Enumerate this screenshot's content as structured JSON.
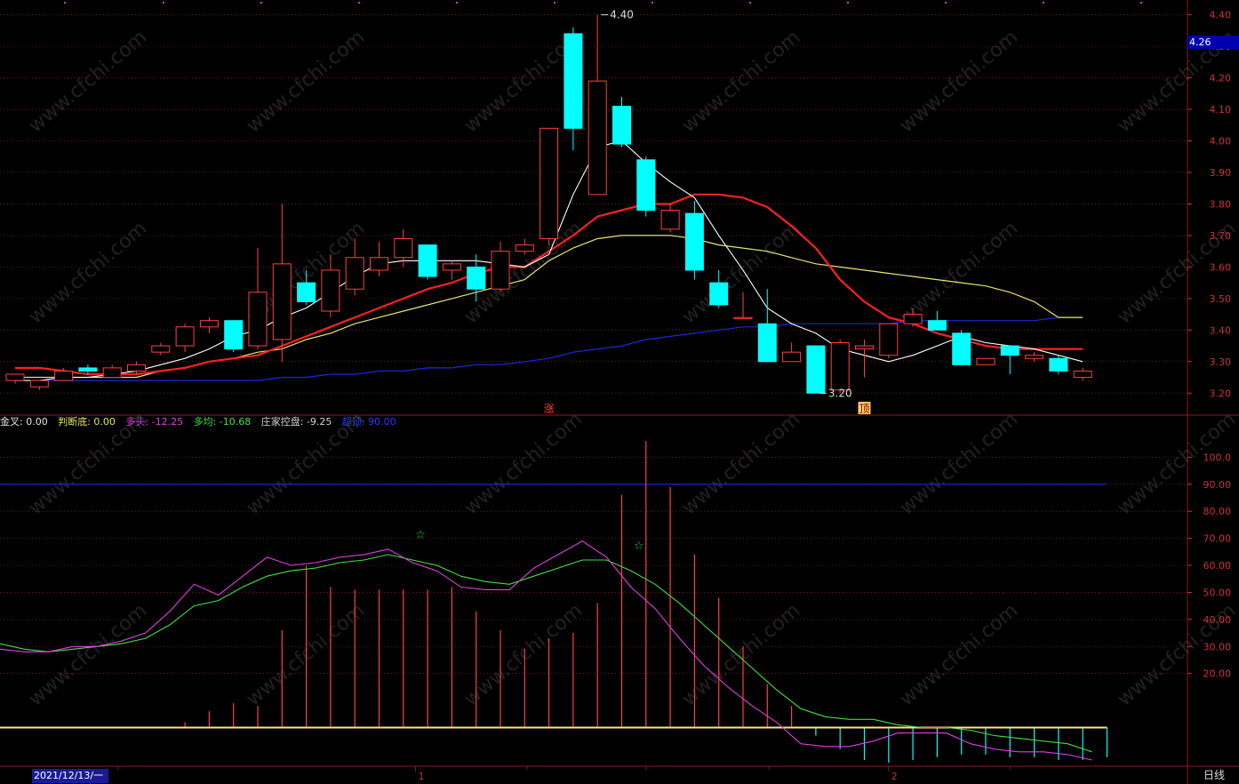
{
  "colors": {
    "up": "#ff4040",
    "down": "#00ffff",
    "ma5": "#ffffff",
    "ma10": "#ff2020",
    "ma20": "#e6e66e",
    "ma60": "#1a2adc",
    "grid": "#8b1a1a",
    "axis_text": "#cc3333",
    "k_line": "#e040e0",
    "d_line": "#40e040",
    "level_line": "#1a2adc",
    "zero_line": "#ffe28a"
  },
  "price_tag": "4.26",
  "chart_data": [
    {
      "type": "candlestick",
      "y_axis_ticks": [
        "3.20",
        "3.30",
        "3.40",
        "3.50",
        "3.60",
        "3.70",
        "3.80",
        "3.90",
        "4.00",
        "4.10",
        "4.20",
        "4.30",
        "4.40"
      ],
      "ylim": [
        3.15,
        4.43
      ],
      "grid": true,
      "candles": [
        {
          "o": 3.24,
          "h": 3.26,
          "l": 3.23,
          "c": 3.26
        },
        {
          "o": 3.22,
          "h": 3.24,
          "l": 3.21,
          "c": 3.24
        },
        {
          "o": 3.24,
          "h": 3.28,
          "l": 3.24,
          "c": 3.27
        },
        {
          "o": 3.28,
          "h": 3.29,
          "l": 3.26,
          "c": 3.27
        },
        {
          "o": 3.25,
          "h": 3.29,
          "l": 3.25,
          "c": 3.28
        },
        {
          "o": 3.27,
          "h": 3.3,
          "l": 3.26,
          "c": 3.29
        },
        {
          "o": 3.33,
          "h": 3.36,
          "l": 3.32,
          "c": 3.35
        },
        {
          "o": 3.35,
          "h": 3.42,
          "l": 3.33,
          "c": 3.41
        },
        {
          "o": 3.41,
          "h": 3.44,
          "l": 3.39,
          "c": 3.43
        },
        {
          "o": 3.43,
          "h": 3.43,
          "l": 3.33,
          "c": 3.34
        },
        {
          "o": 3.35,
          "h": 3.66,
          "l": 3.34,
          "c": 3.52
        },
        {
          "o": 3.37,
          "h": 3.8,
          "l": 3.3,
          "c": 3.61
        },
        {
          "o": 3.55,
          "h": 3.59,
          "l": 3.48,
          "c": 3.49
        },
        {
          "o": 3.46,
          "h": 3.64,
          "l": 3.44,
          "c": 3.59
        },
        {
          "o": 3.53,
          "h": 3.69,
          "l": 3.51,
          "c": 3.63
        },
        {
          "o": 3.59,
          "h": 3.68,
          "l": 3.57,
          "c": 3.63
        },
        {
          "o": 3.63,
          "h": 3.72,
          "l": 3.6,
          "c": 3.69
        },
        {
          "o": 3.67,
          "h": 3.67,
          "l": 3.56,
          "c": 3.57
        },
        {
          "o": 3.59,
          "h": 3.62,
          "l": 3.56,
          "c": 3.61
        },
        {
          "o": 3.6,
          "h": 3.64,
          "l": 3.49,
          "c": 3.53
        },
        {
          "o": 3.53,
          "h": 3.68,
          "l": 3.52,
          "c": 3.65
        },
        {
          "o": 3.65,
          "h": 3.69,
          "l": 3.64,
          "c": 3.67
        },
        {
          "o": 3.69,
          "h": 4.04,
          "l": 3.67,
          "c": 4.04
        },
        {
          "o": 4.34,
          "h": 4.36,
          "l": 3.97,
          "c": 4.04
        },
        {
          "o": 3.83,
          "h": 4.4,
          "l": 3.83,
          "c": 4.19
        },
        {
          "o": 4.11,
          "h": 4.14,
          "l": 3.98,
          "c": 3.99
        },
        {
          "o": 3.94,
          "h": 3.95,
          "l": 3.76,
          "c": 3.78
        },
        {
          "o": 3.72,
          "h": 3.8,
          "l": 3.71,
          "c": 3.78
        },
        {
          "o": 3.77,
          "h": 3.81,
          "l": 3.56,
          "c": 3.59
        },
        {
          "o": 3.55,
          "h": 3.59,
          "l": 3.47,
          "c": 3.48
        },
        {
          "o": 3.44,
          "h": 3.52,
          "l": 3.44,
          "c": 3.44
        },
        {
          "o": 3.42,
          "h": 3.53,
          "l": 3.3,
          "c": 3.3
        },
        {
          "o": 3.3,
          "h": 3.36,
          "l": 3.3,
          "c": 3.33
        },
        {
          "o": 3.35,
          "h": 3.35,
          "l": 3.2,
          "c": 3.2
        },
        {
          "o": 3.21,
          "h": 3.37,
          "l": 3.2,
          "c": 3.36
        },
        {
          "o": 3.34,
          "h": 3.37,
          "l": 3.25,
          "c": 3.35
        },
        {
          "o": 3.32,
          "h": 3.42,
          "l": 3.31,
          "c": 3.42
        },
        {
          "o": 3.42,
          "h": 3.47,
          "l": 3.41,
          "c": 3.45
        },
        {
          "o": 3.43,
          "h": 3.46,
          "l": 3.4,
          "c": 3.4
        },
        {
          "o": 3.39,
          "h": 3.4,
          "l": 3.29,
          "c": 3.29
        },
        {
          "o": 3.29,
          "h": 3.31,
          "l": 3.29,
          "c": 3.31
        },
        {
          "o": 3.35,
          "h": 3.35,
          "l": 3.26,
          "c": 3.32
        },
        {
          "o": 3.31,
          "h": 3.33,
          "l": 3.3,
          "c": 3.32
        },
        {
          "o": 3.31,
          "h": 3.32,
          "l": 3.26,
          "c": 3.27
        },
        {
          "o": 3.25,
          "h": 3.28,
          "l": 3.24,
          "c": 3.27
        }
      ],
      "ma5": [
        3.24,
        3.24,
        3.25,
        3.25,
        3.26,
        3.27,
        3.29,
        3.31,
        3.34,
        3.38,
        3.4,
        3.44,
        3.47,
        3.52,
        3.57,
        3.61,
        3.62,
        3.62,
        3.62,
        3.62,
        3.61,
        3.6,
        3.64,
        3.83,
        3.98,
        4.0,
        3.93,
        3.87,
        3.82,
        3.7,
        3.59,
        3.47,
        3.42,
        3.39,
        3.34,
        3.32,
        3.3,
        3.32,
        3.35,
        3.38,
        3.36,
        3.35,
        3.34,
        3.32,
        3.3
      ],
      "ma10": [
        3.28,
        3.28,
        3.27,
        3.26,
        3.26,
        3.26,
        3.27,
        3.28,
        3.3,
        3.31,
        3.32,
        3.35,
        3.38,
        3.41,
        3.44,
        3.47,
        3.5,
        3.53,
        3.55,
        3.58,
        3.6,
        3.6,
        3.65,
        3.7,
        3.76,
        3.78,
        3.8,
        3.8,
        3.83,
        3.83,
        3.82,
        3.79,
        3.73,
        3.66,
        3.56,
        3.49,
        3.44,
        3.42,
        3.39,
        3.37,
        3.35,
        3.34,
        3.34,
        3.34,
        3.34
      ],
      "ma20": [
        3.25,
        3.25,
        3.25,
        3.25,
        3.25,
        3.25,
        3.27,
        3.28,
        3.3,
        3.31,
        3.33,
        3.34,
        3.37,
        3.39,
        3.42,
        3.44,
        3.46,
        3.48,
        3.5,
        3.52,
        3.54,
        3.56,
        3.62,
        3.66,
        3.69,
        3.7,
        3.7,
        3.7,
        3.69,
        3.67,
        3.66,
        3.65,
        3.63,
        3.61,
        3.6,
        3.59,
        3.58,
        3.57,
        3.56,
        3.55,
        3.54,
        3.52,
        3.49,
        3.44,
        3.44
      ],
      "ma60": [
        3.24,
        3.24,
        3.24,
        3.24,
        3.24,
        3.24,
        3.24,
        3.24,
        3.24,
        3.24,
        3.24,
        3.25,
        3.25,
        3.26,
        3.26,
        3.27,
        3.27,
        3.28,
        3.28,
        3.29,
        3.29,
        3.3,
        3.31,
        3.33,
        3.34,
        3.35,
        3.37,
        3.38,
        3.39,
        3.4,
        3.41,
        3.41,
        3.42,
        3.42,
        3.42,
        3.42,
        3.42,
        3.43,
        3.43,
        3.43,
        3.43,
        3.43,
        3.43,
        3.44,
        3.44
      ],
      "annotations": [
        {
          "text": "4.40",
          "index": 24,
          "value": 4.4,
          "kind": "high"
        },
        {
          "text": "3.20",
          "index": 33,
          "value": 3.2,
          "kind": "low"
        }
      ],
      "markers": [
        {
          "text": "涨",
          "index": 22
        },
        {
          "text": "顶",
          "index": 35
        }
      ]
    },
    {
      "type": "line+bar",
      "legend": [
        {
          "text": "金叉: 0.00",
          "color": "#e6e6e6"
        },
        {
          "text": "判断底: 0.00",
          "color": "#e6e65a"
        },
        {
          "text": "多头: -12.25",
          "color": "#e040e0"
        },
        {
          "text": "多均: -10.68",
          "color": "#40e040"
        },
        {
          "text": "庄家控盘: -9.25",
          "color": "#d0d0d0"
        },
        {
          "text": "超顶: 90.00",
          "color": "#2a3aff"
        }
      ],
      "y_axis_ticks": [
        "20.00",
        "30.00",
        "40.00",
        "50.00",
        "60.00",
        "70.00",
        "80.00",
        "90.00",
        "100.0"
      ],
      "ylim": [
        -13,
        110
      ],
      "level": 90,
      "zero": 0,
      "k": [
        29,
        28,
        28,
        30,
        30,
        32,
        35,
        43,
        53,
        49,
        56,
        63,
        60,
        61,
        63,
        64,
        66,
        61,
        58,
        52,
        51,
        51,
        59,
        64,
        69,
        63,
        52,
        44,
        33,
        23,
        15,
        8,
        2,
        -6,
        -7,
        -7,
        -5,
        -2,
        -2,
        -2,
        -6,
        -8,
        -9,
        -9,
        -10,
        -12
      ],
      "d": [
        31,
        29,
        28,
        29,
        30,
        31,
        33,
        38,
        45,
        47,
        52,
        56,
        58,
        59,
        61,
        62,
        64,
        62,
        60,
        56,
        54,
        53,
        56,
        59,
        62,
        62,
        58,
        53,
        46,
        38,
        30,
        22,
        14,
        7,
        4,
        3,
        3,
        1,
        0,
        0,
        -1,
        -3,
        -4,
        -5,
        -6,
        -9
      ],
      "bars": [
        0,
        0,
        0,
        0,
        0,
        0,
        0,
        2,
        6,
        9,
        8,
        36,
        60,
        52,
        51,
        51,
        51,
        51,
        52,
        43,
        36,
        29,
        33,
        35,
        46,
        86,
        106,
        89,
        64,
        48,
        30,
        16,
        8,
        -3,
        -8,
        -12,
        -13,
        -12,
        -11,
        -10,
        -10,
        -11,
        -11,
        -12,
        -12,
        -11
      ],
      "stars": [
        {
          "text": "☆",
          "index": 17,
          "value": 70
        },
        {
          "text": "☆",
          "index": 26,
          "value": 66
        }
      ]
    }
  ],
  "x_axis": {
    "date_label": "2021/12/13/一",
    "month_ticks": [
      {
        "text": "1",
        "index": 16.5
      },
      {
        "text": "2",
        "index": 36
      }
    ]
  },
  "period_label": "日线",
  "watermark": "www.cfchi.com"
}
